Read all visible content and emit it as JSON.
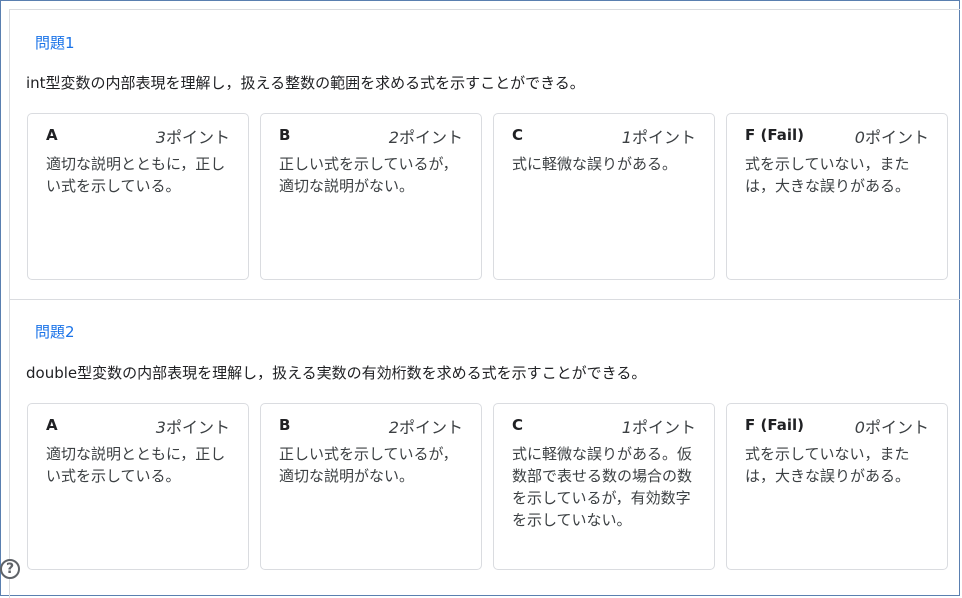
{
  "questions": [
    {
      "title": "問題1",
      "description": "int型変数の内部表現を理解し，扱える整数の範囲を求める式を示すことができる。",
      "levels": [
        {
          "grade": "A",
          "points": "3",
          "unit": "ポイント",
          "description": "適切な説明とともに，正しい式を示している。"
        },
        {
          "grade": "B",
          "points": "2",
          "unit": "ポイント",
          "description": "正しい式を示しているが，適切な説明がない。"
        },
        {
          "grade": "C",
          "points": "1",
          "unit": "ポイント",
          "description": "式に軽微な誤りがある。"
        },
        {
          "grade": "F (Fail)",
          "points": "0",
          "unit": "ポイント",
          "description": "式を示していない，または，大きな誤りがある。"
        }
      ]
    },
    {
      "title": "問題2",
      "description": "double型変数の内部表現を理解し，扱える実数の有効桁数を求める式を示すことができる。",
      "levels": [
        {
          "grade": "A",
          "points": "3",
          "unit": "ポイント",
          "description": "適切な説明とともに，正しい式を示している。"
        },
        {
          "grade": "B",
          "points": "2",
          "unit": "ポイント",
          "description": "正しい式を示しているが，適切な説明がない。"
        },
        {
          "grade": "C",
          "points": "1",
          "unit": "ポイント",
          "description": "式に軽微な誤りがある。仮数部で表せる数の場合の数を示しているが，有効数字を示していない。"
        },
        {
          "grade": "F (Fail)",
          "points": "0",
          "unit": "ポイント",
          "description": "式を示していない，または，大きな誤りがある。"
        }
      ]
    }
  ],
  "help": {
    "icon": "help-icon",
    "symbol": "?"
  }
}
